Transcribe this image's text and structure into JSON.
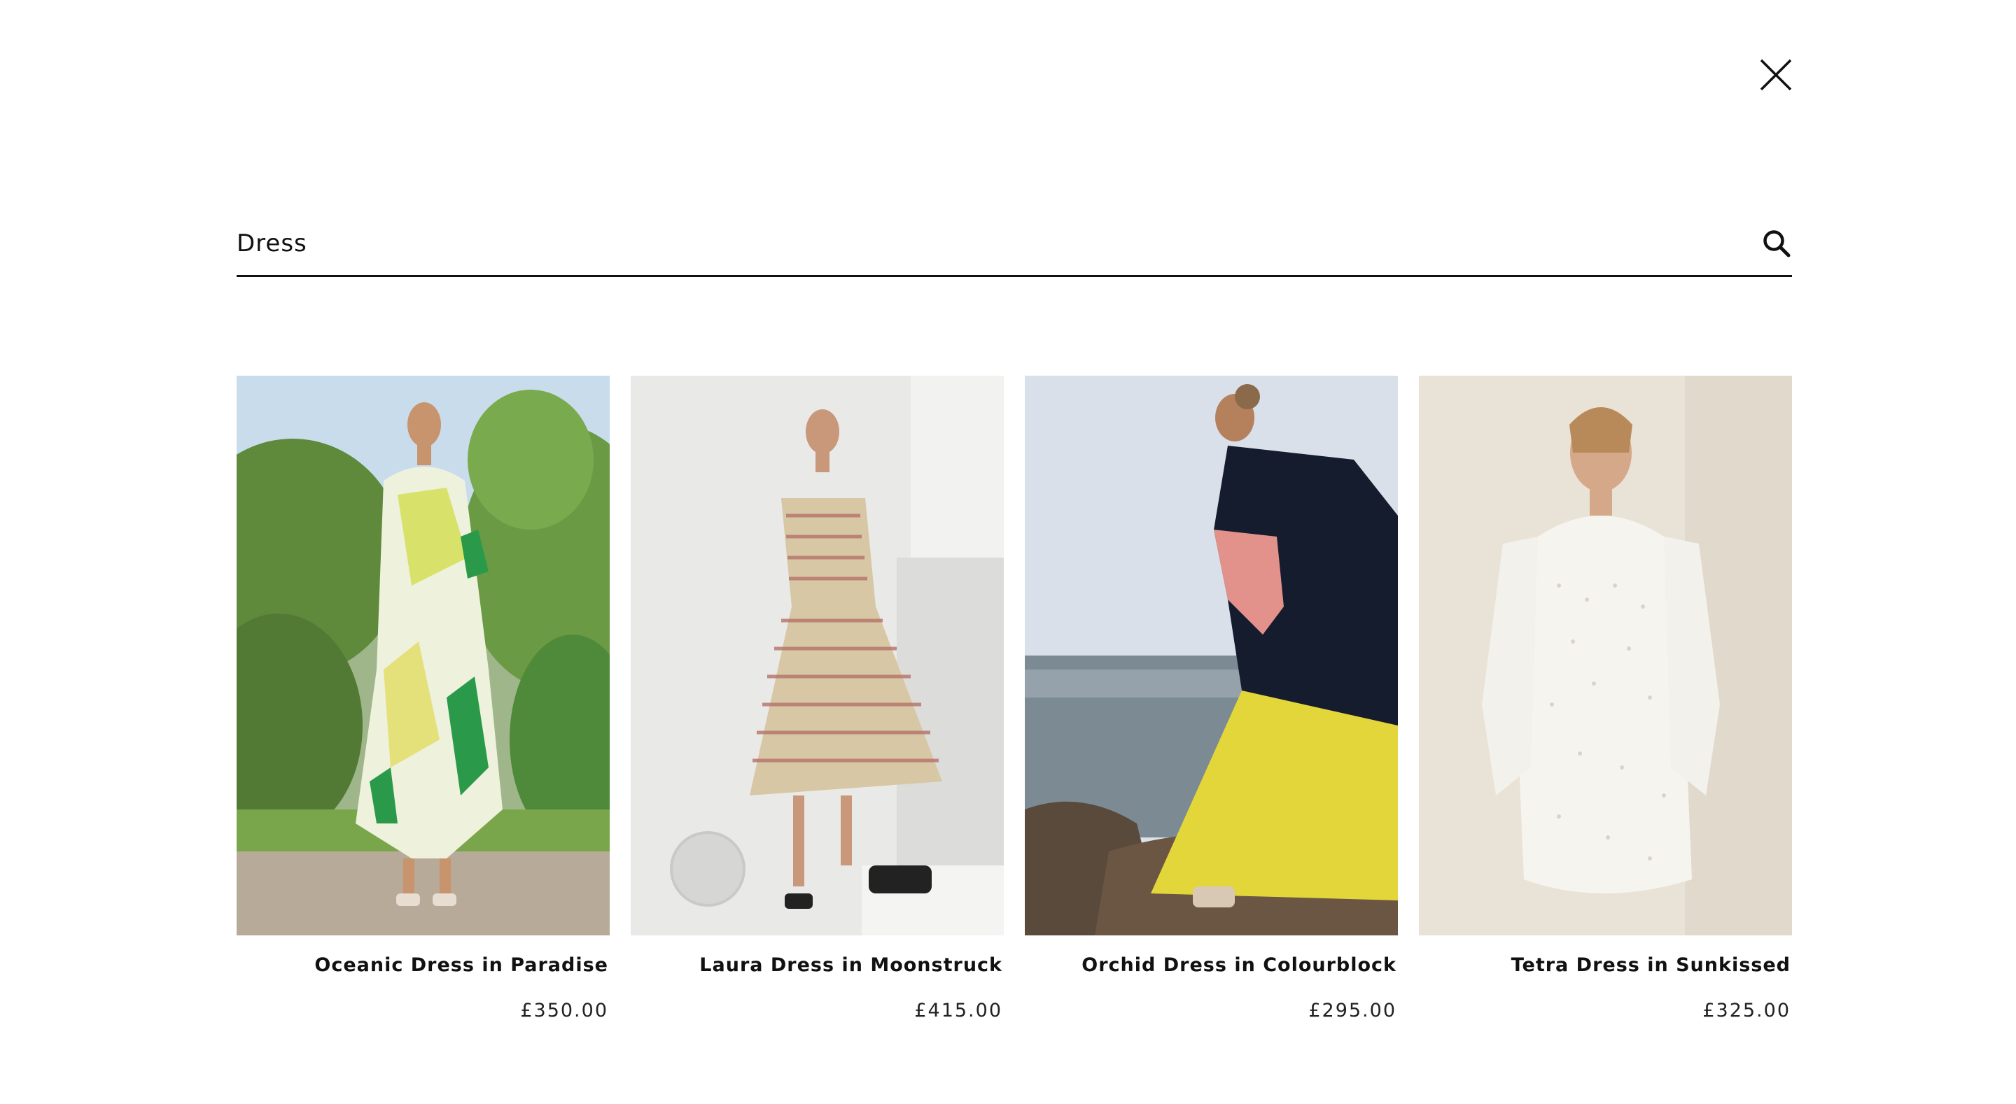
{
  "close_label": "×",
  "search": {
    "value": "Dress",
    "icon": "search-icon"
  },
  "products": [
    {
      "name": "Oceanic Dress in Paradise",
      "price": "£350.00",
      "image": "model in green and yellow print wrap dress in garden"
    },
    {
      "name": "Laura Dress in Moonstruck",
      "price": "£415.00",
      "image": "model in striped tiered sundress on white steps"
    },
    {
      "name": "Orchid Dress in Colourblock",
      "price": "£295.00",
      "image": "model in navy and yellow colourblock dress by the sea"
    },
    {
      "name": "Tetra Dress in Sunkissed",
      "price": "£325.00",
      "image": "model in white broderie mini dress against wall"
    }
  ]
}
